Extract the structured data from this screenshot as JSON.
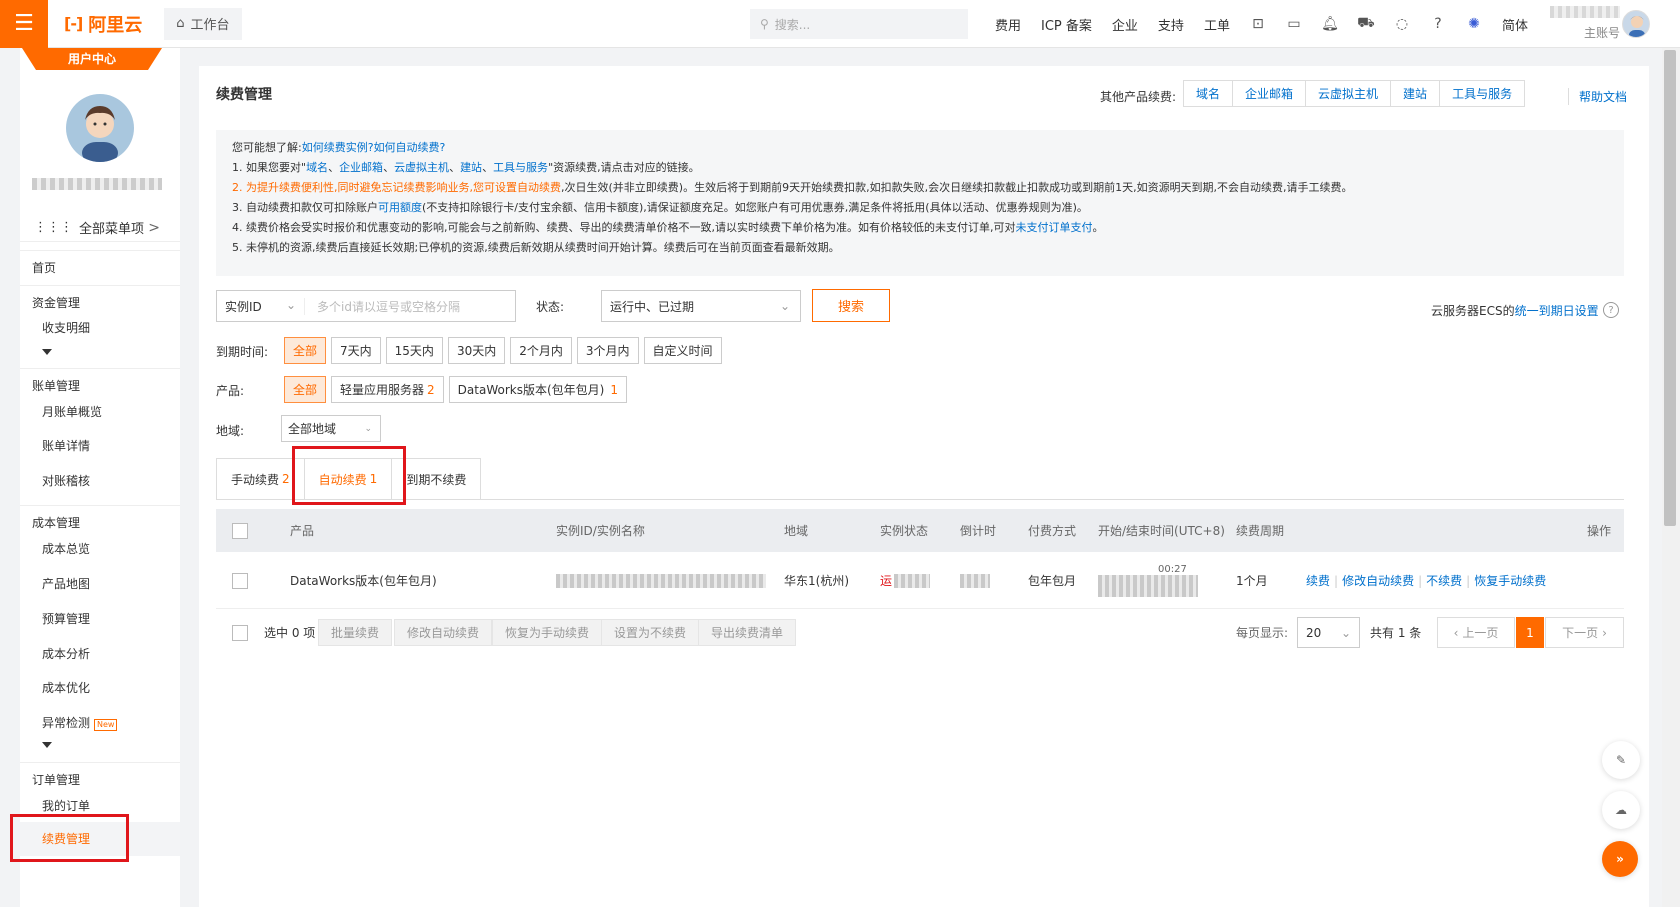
{
  "header": {
    "logo_text": "阿里云",
    "workbench": "工作台",
    "search_placeholder": "搜索...",
    "nav": [
      "费用",
      "ICP 备案",
      "企业",
      "支持",
      "工单"
    ],
    "lang": "简体",
    "account_role": "主账号"
  },
  "sidebar": {
    "badge": "用户中心",
    "all_menu": "全部菜单项",
    "items": {
      "home": "首页",
      "funds": "资金管理",
      "income": "收支明细",
      "bills": "账单管理",
      "monthly": "月账单概览",
      "bill_detail": "账单详情",
      "reconcile": "对账稽核",
      "cost": "成本管理",
      "cost_overview": "成本总览",
      "product_map": "产品地图",
      "budget": "预算管理",
      "cost_analysis": "成本分析",
      "cost_opt": "成本优化",
      "anomaly": "异常检测",
      "new_tag": "New",
      "orders": "订单管理",
      "my_orders": "我的订单",
      "renewal": "续费管理"
    }
  },
  "page": {
    "title": "续费管理",
    "other_products_label": "其他产品续费:",
    "other_products": [
      "域名",
      "企业邮箱",
      "云虚拟主机",
      "建站",
      "工具与服务"
    ],
    "help_doc": "帮助文档"
  },
  "notice": {
    "l0_prefix": "您可能想了解:",
    "l0_link1": "如何续费实例?",
    "l0_link2": "如何自动续费?",
    "l1_a": "1. 如果您要对\"",
    "l1_links": [
      "域名",
      "企业邮箱",
      "云虚拟主机",
      "建站",
      "工具与服务"
    ],
    "l1_b": "\"资源续费,请点击对应的链接。",
    "l2_a": "2.",
    "l2_orange": "为提升续费便利性,同时避免忘记续费影响业务,您可设置自动续费",
    "l2_b": ",次日生效(并非立即续费)。生效后将于到期前9天开始续费扣款,如扣款失败,会次日继续扣款截止扣款成功或到期前1天,如资源明天到期,不会自动续费,请手工续费。",
    "l3_a": "3. 自动续费扣款仅可扣除账户",
    "l3_link": "可用额度",
    "l3_b": "(不支持扣除银行卡/支付宝余额、信用卡额度),请保证额度充足。如您账户有可用优惠券,满足条件将抵用(具体以活动、优惠券规则为准)。",
    "l4_a": "4. 续费价格会受实时报价和优惠变动的影响,可能会与之前新购、续费、导出的续费清单价格不一致,请以实时续费下单价格为准。如有价格较低的未支付订单,可对",
    "l4_link": "未支付订单支付",
    "l4_b": "。",
    "l5": "5. 未停机的资源,续费后直接延长效期;已停机的资源,续费后新效期从续费时间开始计算。续费后可在当前页面查看最新效期。"
  },
  "filters": {
    "id_type": "实例ID",
    "id_placeholder": "多个id请以逗号或空格分隔",
    "status_label": "状态:",
    "status_value": "运行中、已过期",
    "search_btn": "搜索",
    "ecs_text": "云服务器ECS的",
    "ecs_link": "统一到期日设置",
    "expire_label": "到期时间:",
    "expire_options": [
      "全部",
      "7天内",
      "15天内",
      "30天内",
      "2个月内",
      "3个月内",
      "自定义时间"
    ],
    "product_label": "产品:",
    "product_all": "全部",
    "product_opt1": "轻量应用服务器",
    "product_opt1_count": "2",
    "product_opt2": "DataWorks版本(包年包月)",
    "product_opt2_count": "1",
    "region_label": "地域:",
    "region_value": "全部地域"
  },
  "tabs": [
    {
      "label": "手动续费",
      "count": "2"
    },
    {
      "label": "自动续费",
      "count": "1"
    },
    {
      "label": "到期不续费",
      "count": ""
    }
  ],
  "table": {
    "headers": [
      "产品",
      "实例ID/实例名称",
      "地域",
      "实例状态",
      "倒计时",
      "付费方式",
      "开始/结束时间(UTC+8)",
      "续费周期",
      "操作"
    ],
    "row": {
      "product": "DataWorks版本(包年包月)",
      "region": "华东1(杭州)",
      "status_prefix": "运",
      "pay": "包年包月",
      "time_fragment": "00:27",
      "cycle": "1个月",
      "ops": [
        "续费",
        "修改自动续费",
        "不续费",
        "恢复手动续费"
      ]
    }
  },
  "bulk": {
    "selected": "选中 0 项",
    "buttons": [
      "批量续费",
      "修改自动续费",
      "恢复为手动续费",
      "设置为不续费",
      "导出续费清单"
    ],
    "per_page_label": "每页显示:",
    "per_page": "20",
    "total": "共有 1 条",
    "prev": "上一页",
    "page": "1",
    "next": "下一页"
  },
  "colors": {
    "accent": "#ff6a00",
    "link": "#0070cc",
    "highlight_box": "#e0161b"
  }
}
